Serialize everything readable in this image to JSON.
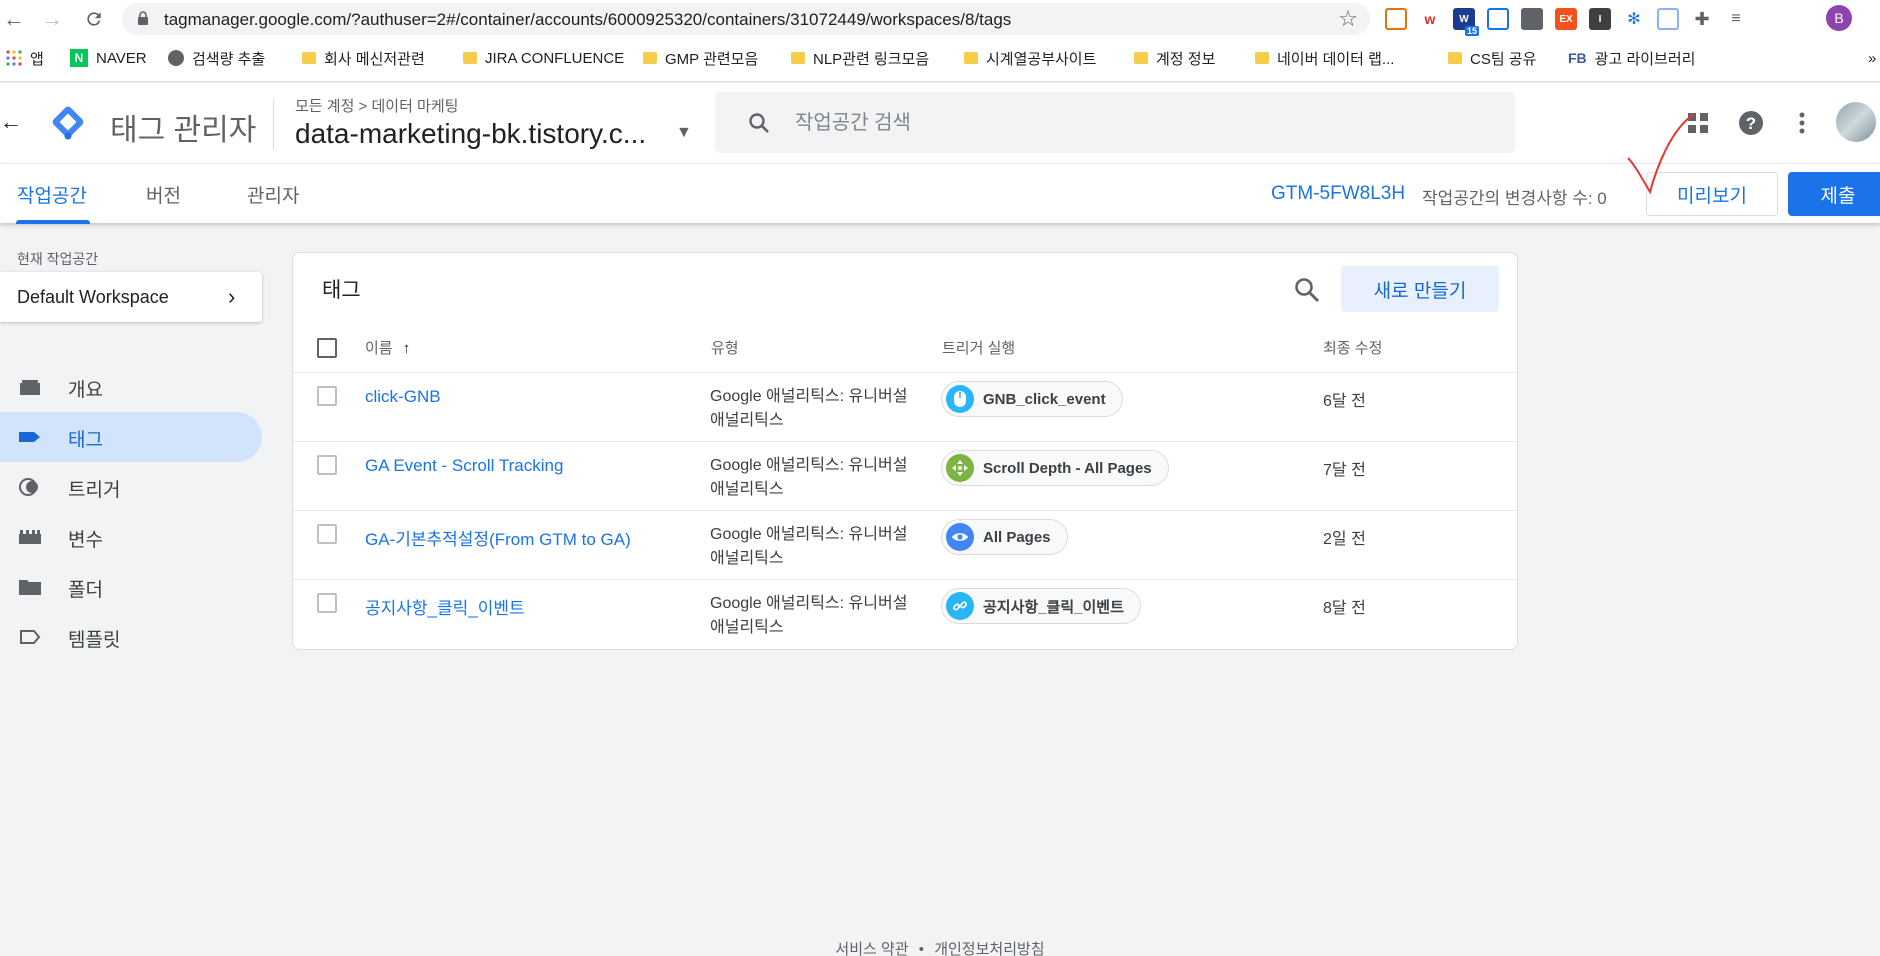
{
  "browser": {
    "url": "tagmanager.google.com/?authuser=2#/container/accounts/6000925320/containers/31072449/workspaces/8/tags",
    "profile_initial": "B",
    "ext_badge_count": "15",
    "ext_ex_label": "EX"
  },
  "bookmarks": {
    "apps": "앱",
    "naver": "NAVER",
    "search_volume": "검색량 추출",
    "company_messenger": "회사 메신저관련",
    "jira": "JIRA CONFLUENCE",
    "gmp": "GMP 관련모음",
    "nlp": "NLP관련 링크모음",
    "timeseries": "시계열공부사이트",
    "account_info": "계정 정보",
    "naver_data": "네이버 데이터 랩...",
    "cs_share": "CS팀 공유",
    "fb_prefix": "FB",
    "fb_library": "광고 라이브러리",
    "more": "»"
  },
  "header": {
    "app_title": "태그 관리자",
    "breadcrumb_all": "모든 계정",
    "breadcrumb_sep": ">",
    "breadcrumb_account": "데이터 마케팅",
    "container_name": "data-marketing-bk.tistory.c...",
    "search_placeholder": "작업공간 검색"
  },
  "subnav": {
    "tabs": [
      {
        "label": "작업공간",
        "active": true
      },
      {
        "label": "버전",
        "active": false
      },
      {
        "label": "관리자",
        "active": false
      }
    ],
    "gtm_id": "GTM-5FW8L3H",
    "changes_label": "작업공간의 변경사항 수: 0",
    "preview_label": "미리보기",
    "submit_label": "제출"
  },
  "sidebar": {
    "current_workspace_label": "현재 작업공간",
    "workspace_name": "Default Workspace",
    "items": [
      {
        "label": "개요",
        "icon": "briefcase-icon",
        "active": false
      },
      {
        "label": "태그",
        "icon": "tag-icon",
        "active": true
      },
      {
        "label": "트리거",
        "icon": "trigger-icon",
        "active": false
      },
      {
        "label": "변수",
        "icon": "variable-icon",
        "active": false
      },
      {
        "label": "폴더",
        "icon": "folder-icon",
        "active": false
      },
      {
        "label": "템플릿",
        "icon": "template-icon",
        "active": false
      }
    ]
  },
  "tags_card": {
    "title": "태그",
    "new_button": "새로 만들기",
    "columns": {
      "name": "이름",
      "sort_indicator": "↑",
      "type": "유형",
      "trigger": "트리거 실행",
      "modified": "최종 수정"
    },
    "rows": [
      {
        "name": "click-GNB",
        "type_line1": "Google 애널리틱스: 유니버설",
        "type_line2": "애널리틱스",
        "trigger": "GNB_click_event",
        "trigger_icon": "mouse-icon",
        "trigger_color": "#29b6f6",
        "modified": "6달 전"
      },
      {
        "name": "GA Event - Scroll Tracking",
        "type_line1": "Google 애널리틱스: 유니버설",
        "type_line2": "애널리틱스",
        "trigger": "Scroll Depth - All Pages",
        "trigger_icon": "scroll-icon",
        "trigger_color": "#7cb342",
        "modified": "7달 전"
      },
      {
        "name": "GA-기본추적설정(From GTM to GA)",
        "type_line1": "Google 애널리틱스: 유니버설",
        "type_line2": "애널리틱스",
        "trigger": "All Pages",
        "trigger_icon": "eye-icon",
        "trigger_color": "#4285f4",
        "modified": "2일 전"
      },
      {
        "name": "공지사항_클릭_이벤트",
        "type_line1": "Google 애널리틱스: 유니버설",
        "type_line2": "애널리틱스",
        "trigger": "공지사항_클릭_이벤트",
        "trigger_icon": "link-icon",
        "trigger_color": "#29b6f6",
        "modified": "8달 전"
      }
    ]
  },
  "footer": {
    "terms": "서비스 약관",
    "dot": "•",
    "privacy": "개인정보처리방침"
  },
  "colors": {
    "accent": "#1a73e8",
    "active_nav_bg": "#d2e3fc"
  }
}
